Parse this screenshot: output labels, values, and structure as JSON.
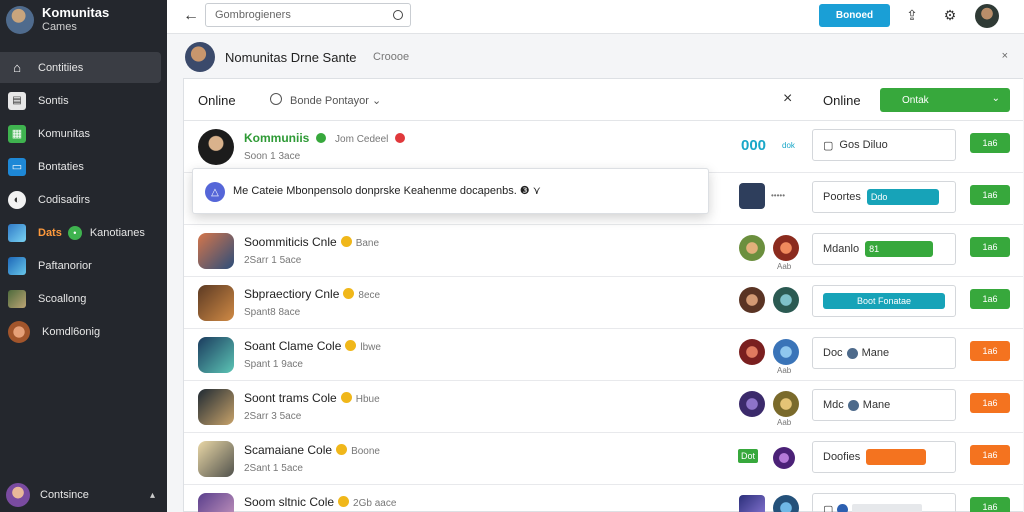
{
  "sidebar": {
    "brand_title": "Komunitas",
    "brand_subtitle": "Cames",
    "items": [
      {
        "label": "Contitiies",
        "icon": "home-icon",
        "active": true
      },
      {
        "label": "Sontis",
        "icon": "stack-icon"
      },
      {
        "label": "Komunitas",
        "icon": "grid-icon"
      },
      {
        "label": "Bontaties",
        "icon": "window-icon"
      },
      {
        "label": "Codisadirs",
        "icon": "circle-icon"
      },
      {
        "label": "Kanotianes",
        "prefix": "Dats",
        "badge": "•",
        "icon": "game-icon"
      },
      {
        "label": "Paftanorior",
        "icon": "game-icon"
      },
      {
        "label": "Scoallong",
        "icon": "character-icon"
      },
      {
        "label": "Komdl6onig",
        "icon": "avatar-icon"
      }
    ],
    "footer_label": "Contsince",
    "footer_chevron": "▴"
  },
  "topbar": {
    "back_icon": "←",
    "search_placeholder": "Gombrogieners",
    "action_button": "Bonoed",
    "icons": [
      "notification-icon",
      "settings-icon"
    ]
  },
  "group": {
    "title": "Nomunitas Drne Sante",
    "subtitle": "Croooe",
    "close": "×"
  },
  "panel": {
    "online_label": "Online",
    "search_text": "Bonde Pontayor",
    "search_chevron": "⌄",
    "close_icon": "×",
    "online_label_right": "Online",
    "select_value": "Ontak",
    "select_chevron": "⌄"
  },
  "toast": {
    "icon": "△",
    "text": "Me Cateie Mbonpensolo donprske Keahenme docapenbs. ❸ ⋎"
  },
  "rows": [
    {
      "name": "Kommuniis",
      "extra": "Jom Cedeel",
      "sub": "Soon 1 3ace",
      "count": "000",
      "count_sub": "dok",
      "box": "Gos Diluo",
      "btn": "1a6",
      "btn_color": "#37a83c"
    },
    {
      "name": "",
      "sub": "",
      "box": "Poortes",
      "chip": "Ddo",
      "chip_color": "#17a3b8",
      "btn": "1a6",
      "btn_color": "#37a83c",
      "mini_label": "•••••"
    },
    {
      "name": "Soommiticis Cnle",
      "extra": "Bane",
      "sub": "2Sarr 1 5ace",
      "box": "Mdanlo",
      "chip": "81",
      "chip_color": "#37a83c",
      "btn": "1a6",
      "btn_color": "#37a83c",
      "mini_label": "Aab"
    },
    {
      "name": "Sbpraectiory Cnle",
      "extra": "8ece",
      "sub": "Spant8 8ace",
      "box": "",
      "chip": "Boot Fonatae",
      "chip_color": "#17a3b8",
      "btn": "1a6",
      "btn_color": "#37a83c"
    },
    {
      "name": "Soant Clame Cole",
      "extra": "lbwe",
      "sub": "Spant 1 9ace",
      "box": "Doc",
      "chip": "Mane",
      "chip_color": "#ffffff",
      "btn": "1a6",
      "btn_color": "#f4731f",
      "mini_label": "Aab"
    },
    {
      "name": "Soont trams Cole",
      "extra": "Hbue",
      "sub": "2Sarr 3 5ace",
      "box": "Mdc",
      "chip": "Mane",
      "chip_color": "#ffffff",
      "btn": "1a6",
      "btn_color": "#f4731f",
      "mini_label": "Aab"
    },
    {
      "name": "Scamaiane Cole",
      "extra": "Boone",
      "sub": "2Sant 1 5ace",
      "box": "Doofies",
      "chip": "",
      "chip_color": "#f4731f",
      "btn": "1a6",
      "btn_color": "#f4731f",
      "tag": "Dot"
    },
    {
      "name": "Soom sltnic Cole",
      "extra": "2Gb aace",
      "sub": "",
      "box": "",
      "btn": "1a6",
      "btn_color": "#37a83c"
    }
  ]
}
